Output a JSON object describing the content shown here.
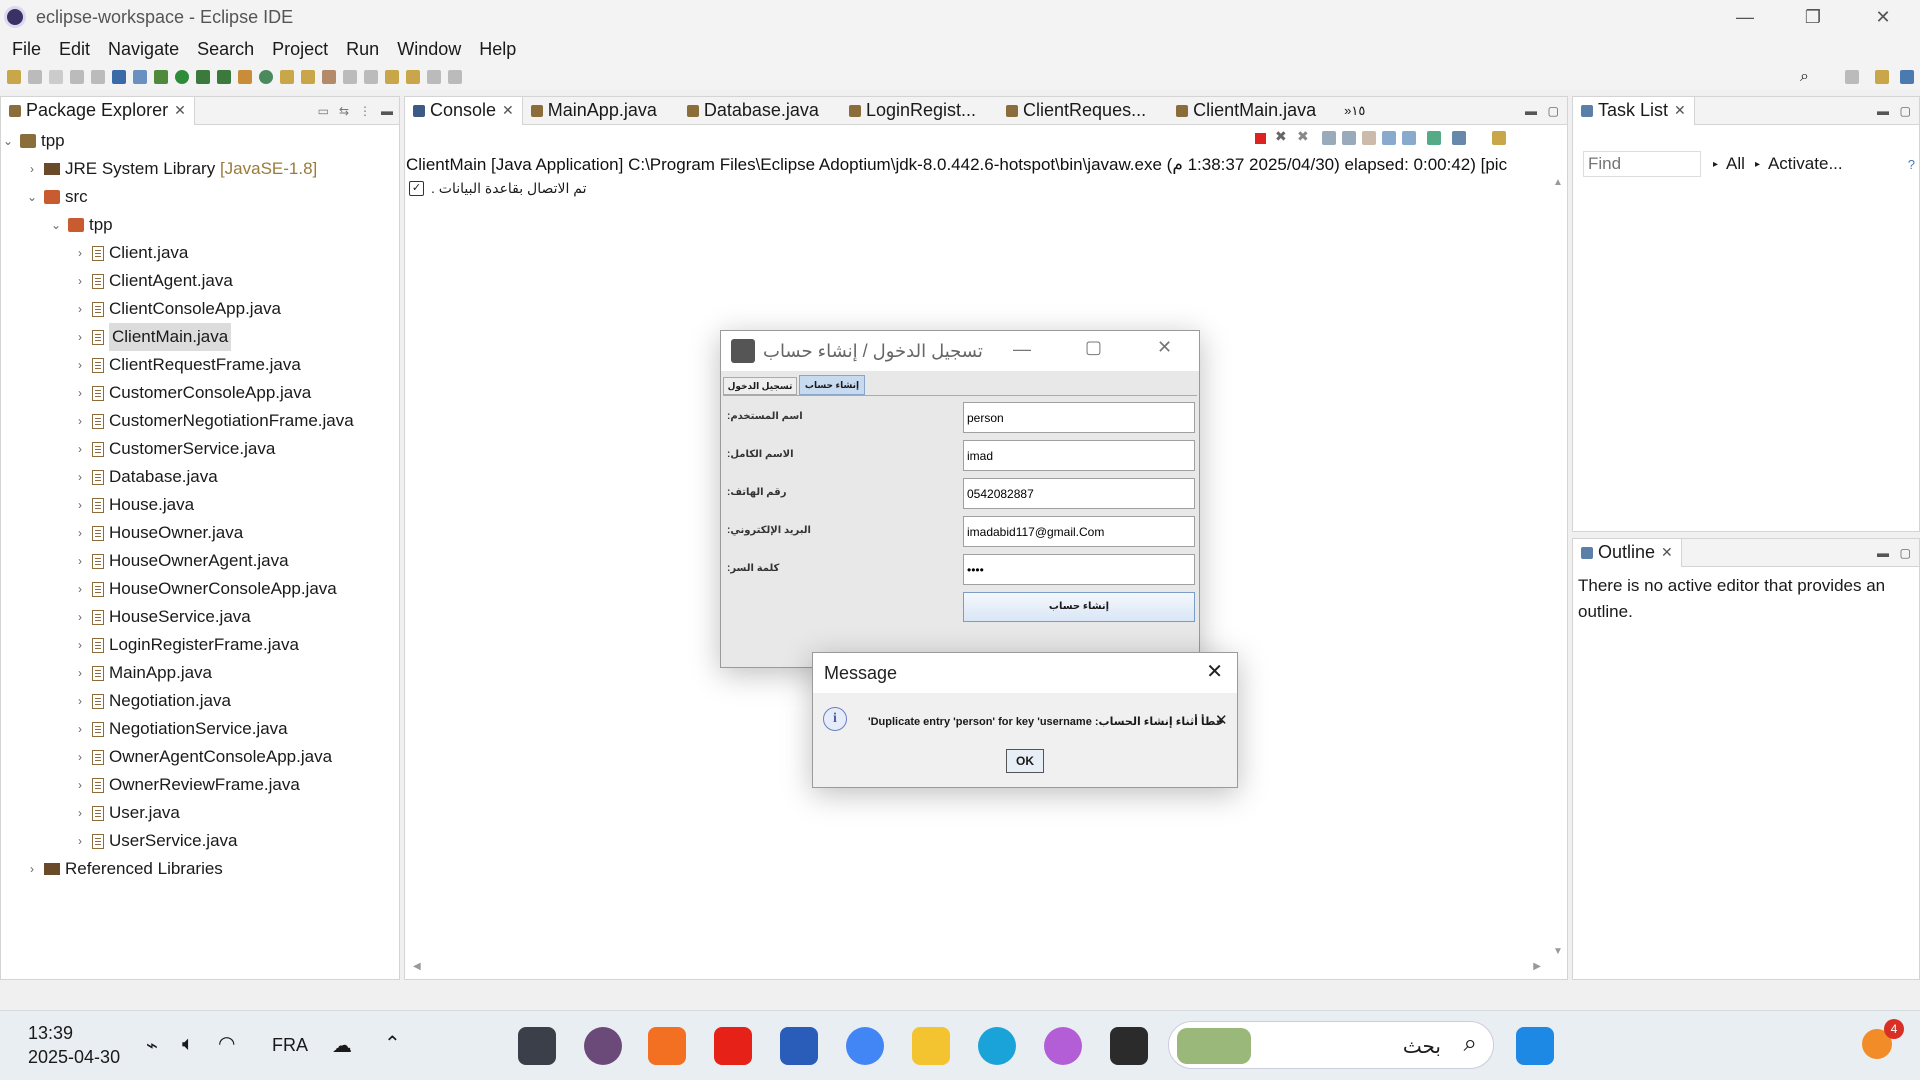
{
  "window": {
    "title": "eclipse-workspace - Eclipse IDE",
    "minimize": "—",
    "maximize": "❐",
    "close": "✕"
  },
  "menu": [
    "File",
    "Edit",
    "Navigate",
    "Search",
    "Project",
    "Run",
    "Window",
    "Help"
  ],
  "package_explorer": {
    "tab": "Package Explorer",
    "project": "tpp",
    "jre_label": "JRE System Library",
    "jre_version": "[JavaSE-1.8]",
    "src": "src",
    "package": "tpp",
    "files": [
      "Client.java",
      "ClientAgent.java",
      "ClientConsoleApp.java",
      "ClientMain.java",
      "ClientRequestFrame.java",
      "CustomerConsoleApp.java",
      "CustomerNegotiationFrame.java",
      "CustomerService.java",
      "Database.java",
      "House.java",
      "HouseOwner.java",
      "HouseOwnerAgent.java",
      "HouseOwnerConsoleApp.java",
      "HouseService.java",
      "LoginRegisterFrame.java",
      "MainApp.java",
      "Negotiation.java",
      "NegotiationService.java",
      "OwnerAgentConsoleApp.java",
      "OwnerReviewFrame.java",
      "User.java",
      "UserService.java"
    ],
    "selected_file": "ClientMain.java",
    "referenced": "Referenced Libraries"
  },
  "editor_tabs": [
    "Console",
    "MainApp.java",
    "Database.java",
    "LoginRegist...",
    "ClientReques...",
    "ClientMain.java"
  ],
  "editor_overflow": "»١٥",
  "console": {
    "header": "ClientMain [Java Application] C:\\Program Files\\Eclipse Adoptium\\jdk-8.0.442.6-hotspot\\bin\\javaw.exe  (‏2025/04/30 1:38:37 م) elapsed: 0:00:42) [pic",
    "line": "تم الاتصال بقاعدة البيانات ."
  },
  "task_list": {
    "tab": "Task List",
    "find_placeholder": "Find",
    "all": "All",
    "activate": "Activate..."
  },
  "outline": {
    "tab": "Outline",
    "message": "There is no active editor that provides an outline."
  },
  "login_window": {
    "title": "تسجيل الدخول / إنشاء حساب",
    "tabs": [
      "تسجيل الدخول",
      "إنشاء حساب"
    ],
    "active_tab": 1,
    "fields": [
      {
        "label": "اسم المستخدم:",
        "value": "person"
      },
      {
        "label": "الاسم الكامل:",
        "value": "imad"
      },
      {
        "label": "رقم الهاتف:",
        "value": "0542082887"
      },
      {
        "label": "البريد الإلكتروني:",
        "value": "imadabid117@gmail.Com"
      },
      {
        "label": "كلمة السر:",
        "value": "••••"
      }
    ],
    "submit": "إنشاء حساب"
  },
  "message_dialog": {
    "title": "Message",
    "text": "'Duplicate entry 'person' for key 'username :خطأ أثناء إنشاء الحساب",
    "ok": "OK"
  },
  "taskbar": {
    "time": "13:39",
    "date": "2025-04-30",
    "lang": "FRA",
    "search_placeholder": "بحث",
    "notification_count": "4"
  },
  "colors": {
    "accent": "#1a73e8",
    "selection": "#dcdcdc",
    "panel_border": "#d4d4d4",
    "toolbar_bg": "#f3f3f3"
  }
}
